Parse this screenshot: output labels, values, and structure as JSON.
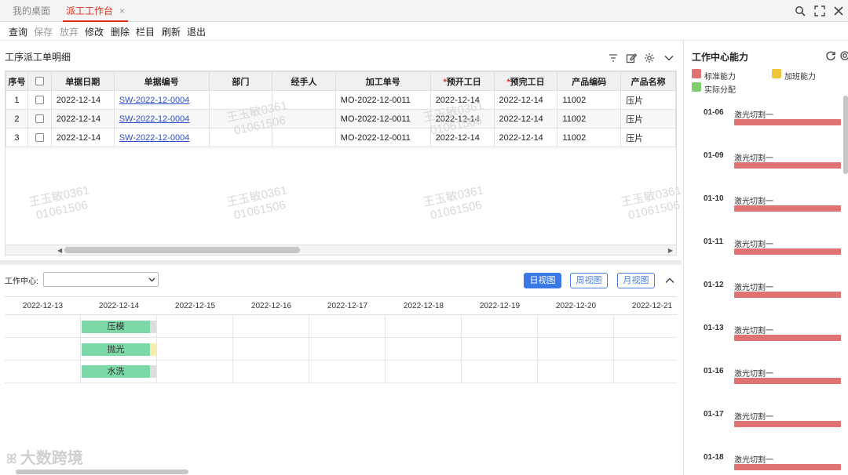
{
  "tabs": [
    {
      "label": "我的桌面"
    },
    {
      "label": "派工工作台",
      "close": "×"
    }
  ],
  "toolbar": {
    "query": "查询",
    "save": "保存",
    "discard": "放弃",
    "edit": "修改",
    "delete": "删除",
    "columns": "栏目",
    "refresh": "刷新",
    "exit": "退出"
  },
  "detail": {
    "title": "工序派工单明细",
    "headers": [
      "序号",
      "",
      "单据日期",
      "单据编号",
      "部门",
      "经手人",
      "加工单号",
      "预开工日",
      "预完工日",
      "产品编码",
      "产品名称"
    ],
    "rows": [
      {
        "no": "1",
        "date": "2022-12-14",
        "code": "SW-2022-12-0004",
        "dept": "",
        "handler": "",
        "mo": "MO-2022-12-0011",
        "start": "2022-12-14",
        "end": "2022-12-14",
        "pcode": "11002",
        "pname": "压片"
      },
      {
        "no": "2",
        "date": "2022-12-14",
        "code": "SW-2022-12-0004",
        "dept": "",
        "handler": "",
        "mo": "MO-2022-12-0011",
        "start": "2022-12-14",
        "end": "2022-12-14",
        "pcode": "11002",
        "pname": "压片"
      },
      {
        "no": "3",
        "date": "2022-12-14",
        "code": "SW-2022-12-0004",
        "dept": "",
        "handler": "",
        "mo": "MO-2022-12-0011",
        "start": "2022-12-14",
        "end": "2022-12-14",
        "pcode": "11002",
        "pname": "压片"
      }
    ]
  },
  "gantt": {
    "work_center_label": "工作中心:",
    "work_center_value": "",
    "views": {
      "day": "日视图",
      "week": "周视图",
      "month": "月视图"
    },
    "dates": [
      "2022-12-13",
      "2022-12-14",
      "2022-12-15",
      "2022-12-16",
      "2022-12-17",
      "2022-12-18",
      "2022-12-19",
      "2022-12-20",
      "2022-12-21"
    ],
    "tasks": [
      {
        "label": "压模"
      },
      {
        "label": "抛光"
      },
      {
        "label": "水洗"
      }
    ]
  },
  "capacity": {
    "title": "工作中心能力",
    "legend": [
      {
        "label": "标准能力",
        "color": "#e07272"
      },
      {
        "label": "加班能力",
        "color": "#f0c53a"
      },
      {
        "label": "实际分配",
        "color": "#7ccf6a"
      }
    ],
    "days": [
      {
        "day": "01-06",
        "name": "激光切割一"
      },
      {
        "day": "01-09",
        "name": "激光切割一"
      },
      {
        "day": "01-10",
        "name": "激光切割一"
      },
      {
        "day": "01-11",
        "name": "激光切割一"
      },
      {
        "day": "01-12",
        "name": "激光切割一"
      },
      {
        "day": "01-13",
        "name": "激光切割一"
      },
      {
        "day": "01-16",
        "name": "激光切割一"
      },
      {
        "day": "01-17",
        "name": "激光切割一"
      },
      {
        "day": "01-18",
        "name": "激光切割一"
      }
    ]
  },
  "watermark": {
    "line1": "王玉敏0361",
    "line2": "01061506"
  },
  "logo": "大数跨境"
}
